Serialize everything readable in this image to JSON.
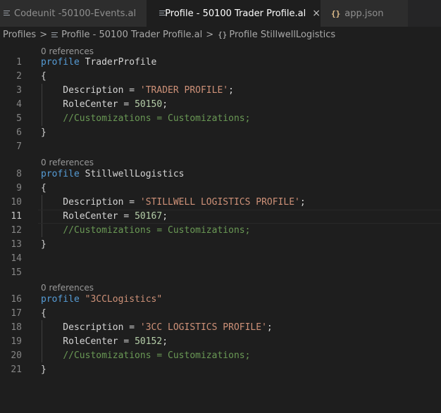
{
  "tabs": [
    {
      "label": "Codeunit -50100-Events.al",
      "icon": "file-lines-icon",
      "active": false
    },
    {
      "label": "Profile - 50100 Trader Profile.al",
      "icon": "file-lines-icon",
      "active": true,
      "close": "×"
    },
    {
      "label": "app.json",
      "icon": "json-braces-icon",
      "active": false
    }
  ],
  "breadcrumb": {
    "root": "Profiles",
    "separator": ">",
    "file": "Profile - 50100 Trader Profile.al",
    "symbol_icon": "{}",
    "symbol": "Profile StillwellLogistics"
  },
  "editor": {
    "active_line": 11,
    "codelens": "0 references",
    "lines": [
      {
        "n": "1",
        "tokens": [
          {
            "t": "kw",
            "v": "profile"
          },
          {
            "t": "pl",
            "v": " TraderProfile"
          }
        ]
      },
      {
        "n": "2",
        "tokens": [
          {
            "t": "pl",
            "v": "{"
          }
        ]
      },
      {
        "n": "3",
        "tokens": [
          {
            "t": "pl",
            "v": "    Description = "
          },
          {
            "t": "str",
            "v": "'TRADER PROFILE'"
          },
          {
            "t": "pl",
            "v": ";"
          }
        ]
      },
      {
        "n": "4",
        "tokens": [
          {
            "t": "pl",
            "v": "    RoleCenter = "
          },
          {
            "t": "num",
            "v": "50150"
          },
          {
            "t": "pl",
            "v": ";"
          }
        ]
      },
      {
        "n": "5",
        "tokens": [
          {
            "t": "pl",
            "v": "    "
          },
          {
            "t": "cmt",
            "v": "//Customizations = Customizations;"
          }
        ]
      },
      {
        "n": "6",
        "tokens": [
          {
            "t": "pl",
            "v": "}"
          }
        ]
      },
      {
        "n": "7",
        "tokens": []
      },
      {
        "n": "8",
        "tokens": [
          {
            "t": "kw",
            "v": "profile"
          },
          {
            "t": "pl",
            "v": " StillwellLogistics"
          }
        ]
      },
      {
        "n": "9",
        "tokens": [
          {
            "t": "pl",
            "v": "{"
          }
        ]
      },
      {
        "n": "10",
        "tokens": [
          {
            "t": "pl",
            "v": "    Description = "
          },
          {
            "t": "str",
            "v": "'STILLWELL LOGISTICS PROFILE'"
          },
          {
            "t": "pl",
            "v": ";"
          }
        ]
      },
      {
        "n": "11",
        "tokens": [
          {
            "t": "pl",
            "v": "    RoleCenter = "
          },
          {
            "t": "num",
            "v": "50167"
          },
          {
            "t": "pl",
            "v": ";"
          }
        ]
      },
      {
        "n": "12",
        "tokens": [
          {
            "t": "pl",
            "v": "    "
          },
          {
            "t": "cmt",
            "v": "//Customizations = Customizations;"
          }
        ]
      },
      {
        "n": "13",
        "tokens": [
          {
            "t": "pl",
            "v": "}"
          }
        ]
      },
      {
        "n": "14",
        "tokens": []
      },
      {
        "n": "15",
        "tokens": []
      },
      {
        "n": "16",
        "tokens": [
          {
            "t": "kw",
            "v": "profile"
          },
          {
            "t": "pl",
            "v": " "
          },
          {
            "t": "str",
            "v": "\"3CCLogistics\""
          }
        ]
      },
      {
        "n": "17",
        "tokens": [
          {
            "t": "pl",
            "v": "{"
          }
        ]
      },
      {
        "n": "18",
        "tokens": [
          {
            "t": "pl",
            "v": "    Description = "
          },
          {
            "t": "str",
            "v": "'3CC LOGISTICS PROFILE'"
          },
          {
            "t": "pl",
            "v": ";"
          }
        ]
      },
      {
        "n": "19",
        "tokens": [
          {
            "t": "pl",
            "v": "    RoleCenter = "
          },
          {
            "t": "num",
            "v": "50152"
          },
          {
            "t": "pl",
            "v": ";"
          }
        ]
      },
      {
        "n": "20",
        "tokens": [
          {
            "t": "pl",
            "v": "    "
          },
          {
            "t": "cmt",
            "v": "//Customizations = Customizations;"
          }
        ]
      },
      {
        "n": "21",
        "tokens": [
          {
            "t": "pl",
            "v": "}"
          }
        ]
      }
    ]
  }
}
